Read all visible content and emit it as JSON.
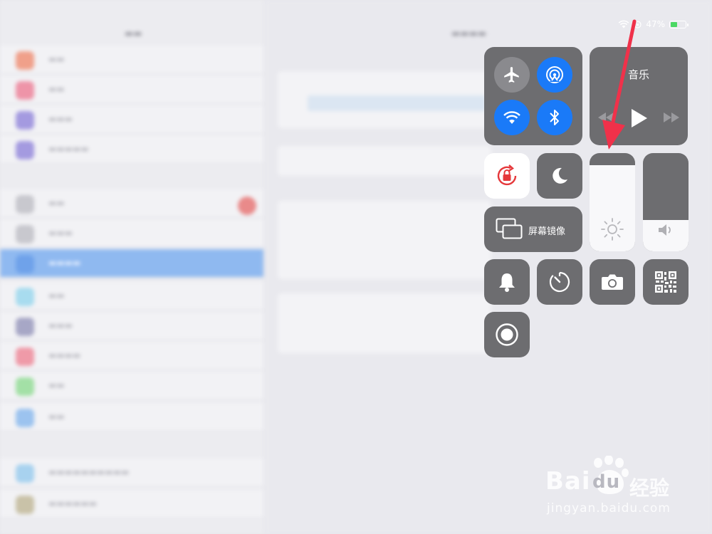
{
  "status_bar": {
    "battery_text": "47%",
    "battery_level": 0.47
  },
  "control_center": {
    "connectivity": {
      "airplane_mode": false,
      "airdrop": true,
      "wifi": true,
      "bluetooth": true
    },
    "music": {
      "title": "音乐"
    },
    "screen_mirroring": {
      "label": "屏幕镜像"
    },
    "brightness_level": 0.88,
    "volume_level": 0.32,
    "icons": [
      "airplane-icon",
      "airdrop-icon",
      "wifi-icon",
      "bluetooth-icon",
      "rotation-lock-icon",
      "moon-icon",
      "screen-mirror-icon",
      "sun-icon",
      "speaker-icon",
      "bell-icon",
      "timer-icon",
      "camera-icon",
      "qr-code-icon",
      "record-icon"
    ]
  },
  "colors": {
    "tile": "#6d6d70",
    "accent_blue": "#1a7af8",
    "rotation_lock_red": "#e5383b",
    "annotation_arrow": "#f0314a"
  },
  "watermark": {
    "brand": "Bai",
    "brand_tail": "du",
    "chinese": "经验",
    "url": "jingyan.baidu.com"
  }
}
